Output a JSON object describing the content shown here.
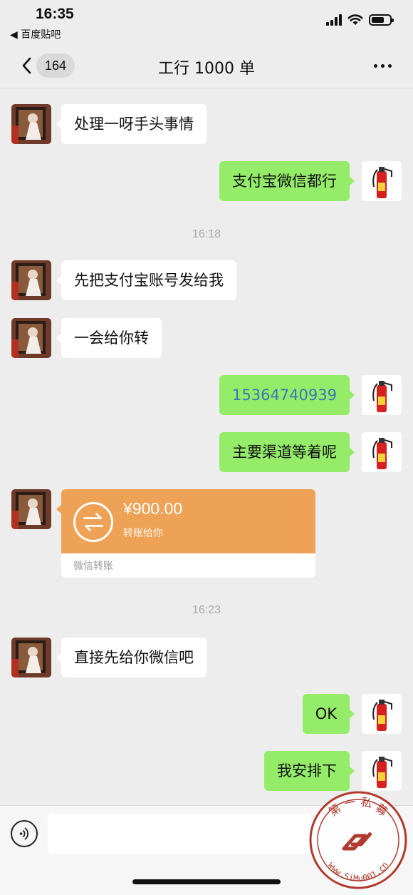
{
  "status_bar": {
    "time": "16:35",
    "back_app": "◀ 百度贴吧"
  },
  "nav": {
    "unread_count": "164",
    "title": "工行 1000 单"
  },
  "messages": {
    "m1": "处理一呀手头事情",
    "m2": "支付宝微信都行",
    "t1": "16:18",
    "m3": "先把支付宝账号发给我",
    "m4": "一会给你转",
    "m5": "15364740939",
    "m6": "主要渠道等着呢",
    "transfer": {
      "amount": "¥900.00",
      "note": "转账给你",
      "source": "微信转账"
    },
    "t2": "16:23",
    "m7": "直接先给你微信吧",
    "m8": "OK",
    "m9": "我安排下"
  },
  "watermark": {
    "top_text": "第 一 私 募",
    "bottom_text": "www.SiMu001.cn"
  },
  "colors": {
    "sent_bubble": "#95ec69",
    "received_bubble": "#ffffff",
    "transfer": "#eea255",
    "background": "#ededed"
  },
  "icons": {
    "back": "chevron-left-icon",
    "more": "ellipsis-icon",
    "voice": "voice-icon",
    "transfer": "transfer-arrows-icon"
  }
}
